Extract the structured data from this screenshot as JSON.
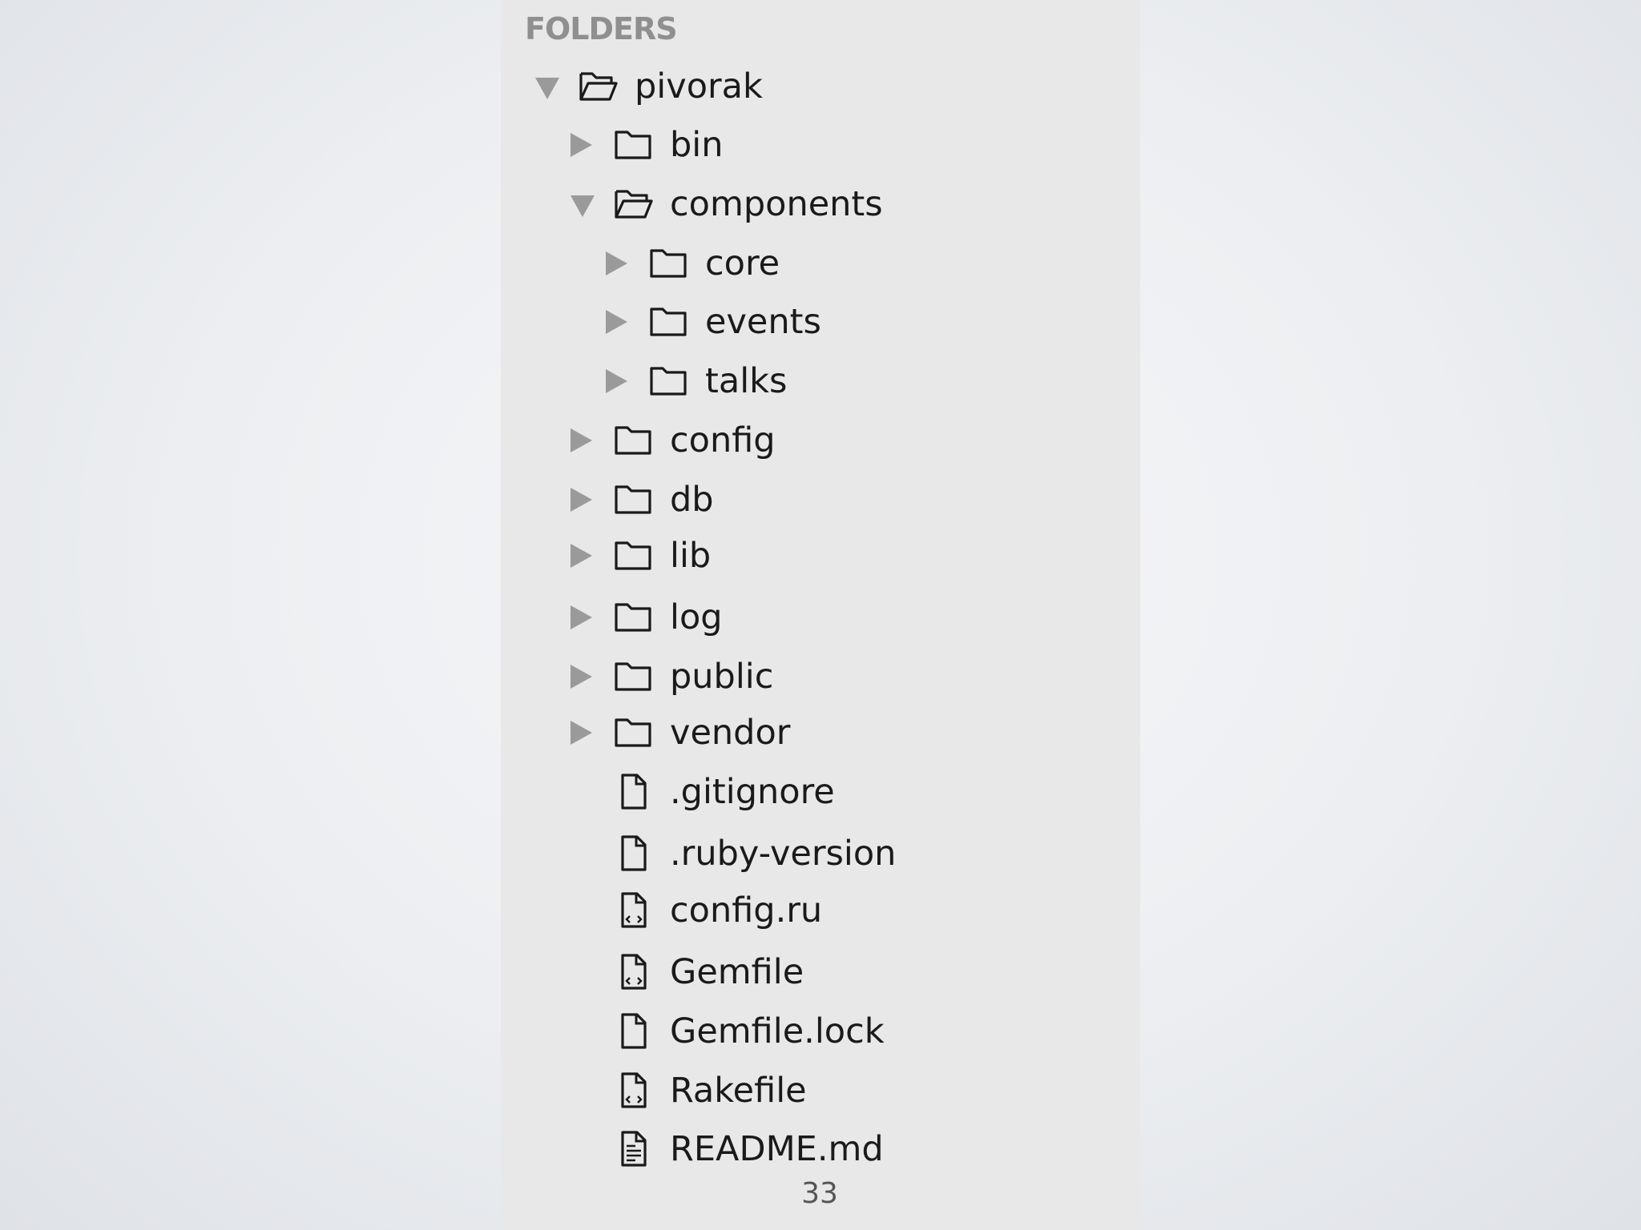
{
  "sidebar": {
    "header": "FOLDERS",
    "items": [
      {
        "label": "pivorak",
        "icon": "folder-open-icon",
        "state": "expanded"
      },
      {
        "label": "bin",
        "icon": "folder-icon",
        "state": "collapsed"
      },
      {
        "label": "components",
        "icon": "folder-open-icon",
        "state": "expanded"
      },
      {
        "label": "core",
        "icon": "folder-icon",
        "state": "collapsed"
      },
      {
        "label": "events",
        "icon": "folder-icon",
        "state": "collapsed"
      },
      {
        "label": "talks",
        "icon": "folder-icon",
        "state": "collapsed"
      },
      {
        "label": "config",
        "icon": "folder-icon",
        "state": "collapsed"
      },
      {
        "label": "db",
        "icon": "folder-icon",
        "state": "collapsed"
      },
      {
        "label": "lib",
        "icon": "folder-icon",
        "state": "collapsed"
      },
      {
        "label": "log",
        "icon": "folder-icon",
        "state": "collapsed"
      },
      {
        "label": "public",
        "icon": "folder-icon",
        "state": "collapsed"
      },
      {
        "label": "vendor",
        "icon": "folder-icon",
        "state": "collapsed"
      },
      {
        "label": ".gitignore",
        "icon": "file-icon"
      },
      {
        "label": ".ruby-version",
        "icon": "file-icon"
      },
      {
        "label": "config.ru",
        "icon": "code-file-icon"
      },
      {
        "label": "Gemfile",
        "icon": "code-file-icon"
      },
      {
        "label": "Gemfile.lock",
        "icon": "file-icon"
      },
      {
        "label": "Rakefile",
        "icon": "code-file-icon"
      },
      {
        "label": "README.md",
        "icon": "text-file-icon"
      }
    ]
  },
  "page_number": "33",
  "colors": {
    "sidebar_bg": "#e8e8e8",
    "header_text": "#8f8f8f",
    "arrow": "#9a9a9a",
    "item_text": "#1a1a1a"
  }
}
